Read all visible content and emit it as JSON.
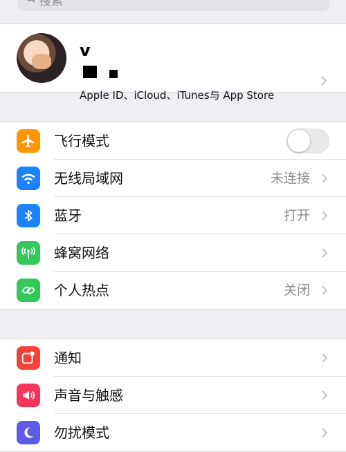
{
  "search": {
    "placeholder": "搜索"
  },
  "profile": {
    "name": "v",
    "subtitle": "Apple ID、iCloud、iTunes与 App Store"
  },
  "group1": [
    {
      "id": "airplane",
      "label": "飞行模式",
      "value": "",
      "icon": "airplane-icon",
      "color": "#ff9500",
      "toggle": "off"
    },
    {
      "id": "wifi",
      "label": "无线局域网",
      "value": "未连接",
      "icon": "wifi-icon",
      "color": "#1a82fb"
    },
    {
      "id": "bluetooth",
      "label": "蓝牙",
      "value": "打开",
      "icon": "bluetooth-icon",
      "color": "#1a82fb"
    },
    {
      "id": "cellular",
      "label": "蜂窝网络",
      "value": "",
      "icon": "antenna-icon",
      "color": "#34c759"
    },
    {
      "id": "hotspot",
      "label": "个人热点",
      "value": "关闭",
      "icon": "hotspot-link-icon",
      "color": "#34c759"
    }
  ],
  "group2": [
    {
      "id": "notifications",
      "label": "通知",
      "value": "",
      "icon": "notification-icon",
      "color": "#f44336"
    },
    {
      "id": "sounds",
      "label": "声音与触感",
      "value": "",
      "icon": "speaker-icon",
      "color": "#f5365c"
    },
    {
      "id": "dnd",
      "label": "勿扰模式",
      "value": "",
      "icon": "moon-icon",
      "color": "#5e5ce6"
    }
  ]
}
